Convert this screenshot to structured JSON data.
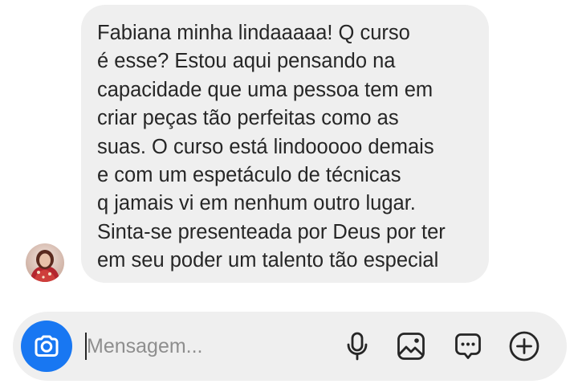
{
  "message": {
    "lines": [
      "Fabiana minha lindaaaaa! Q curso",
      "é esse? Estou aqui pensando na",
      "capacidade que uma pessoa tem em",
      "criar peças tão perfeitas como as",
      "suas. O curso está lindooooo demais",
      "e com um espetáculo de técnicas",
      "q jamais vi em nenhum outro lugar.",
      "Sinta-se presenteada por Deus por ter",
      "em seu poder um talento tão especial"
    ]
  },
  "composer": {
    "placeholder": "Mensagem...",
    "value": ""
  },
  "icons": {
    "camera": "camera-icon",
    "mic": "microphone-icon",
    "gallery": "image-gallery-icon",
    "sticker": "chat-bubble-icon",
    "plus": "plus-circle-icon"
  },
  "colors": {
    "bubble_bg": "#efefef",
    "composer_bg": "#efefef",
    "camera_button": "#1877f2",
    "text": "#262626",
    "placeholder": "#8e8e8e"
  }
}
